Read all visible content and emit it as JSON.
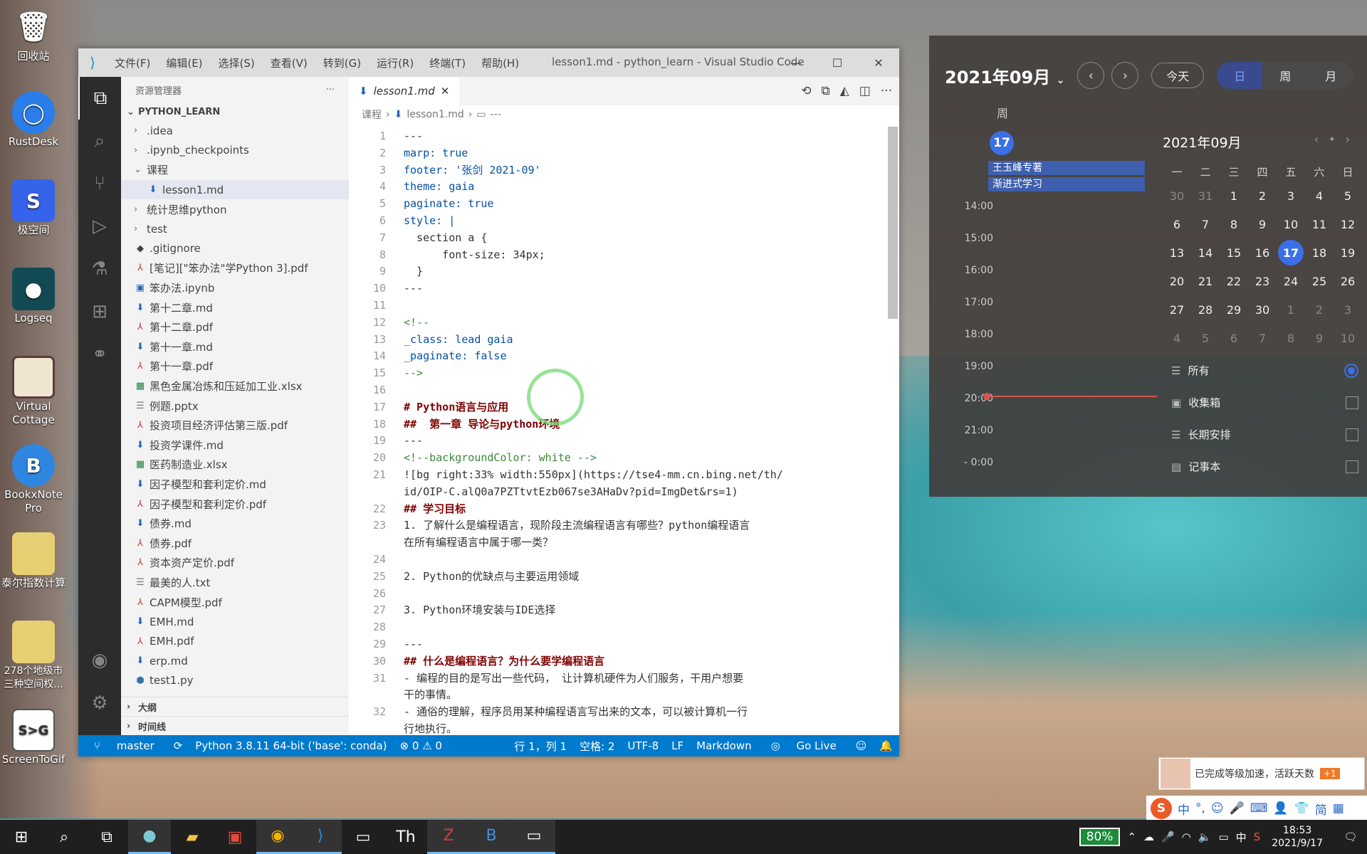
{
  "desktop": {
    "icons": [
      "回收站",
      "RustDesk",
      "极空间",
      "Logseq",
      "Virtual Cottage",
      "BookxNote Pro",
      "泰尔指数计算",
      "278个地级市三种空间权...",
      "ScreenToGif"
    ]
  },
  "vscode": {
    "menu": [
      "文件(F)",
      "编辑(E)",
      "选择(S)",
      "查看(V)",
      "转到(G)",
      "运行(R)",
      "终端(T)",
      "帮助(H)"
    ],
    "title": "lesson1.md - python_learn - Visual Studio Code",
    "explorer_title": "资源管理器",
    "explorer_more": "···",
    "root": "PYTHON_LEARN",
    "tree": [
      {
        "label": ".idea",
        "kind": "folder",
        "open": false,
        "indent": 1
      },
      {
        "label": ".ipynb_checkpoints",
        "kind": "folder",
        "open": false,
        "indent": 1
      },
      {
        "label": "课程",
        "kind": "folder",
        "open": true,
        "indent": 1
      },
      {
        "label": "lesson1.md",
        "kind": "md",
        "indent": 2,
        "selected": true
      },
      {
        "label": "统计思维python",
        "kind": "folder",
        "open": false,
        "indent": 1
      },
      {
        "label": "test",
        "kind": "folder",
        "open": false,
        "indent": 1
      },
      {
        "label": ".gitignore",
        "kind": "git",
        "indent": 1
      },
      {
        "label": "[笔记][\"笨办法\"学Python 3].pdf",
        "kind": "pdf",
        "indent": 1
      },
      {
        "label": "笨办法.ipynb",
        "kind": "ipynb",
        "indent": 1
      },
      {
        "label": "第十二章.md",
        "kind": "md",
        "indent": 1
      },
      {
        "label": "第十二章.pdf",
        "kind": "pdf",
        "indent": 1
      },
      {
        "label": "第十一章.md",
        "kind": "md",
        "indent": 1
      },
      {
        "label": "第十一章.pdf",
        "kind": "pdf",
        "indent": 1
      },
      {
        "label": "黑色金属冶炼和压延加工业.xlsx",
        "kind": "xlsx",
        "indent": 1
      },
      {
        "label": "例题.pptx",
        "kind": "txt",
        "indent": 1
      },
      {
        "label": "投资项目经济评估第三版.pdf",
        "kind": "pdf",
        "indent": 1
      },
      {
        "label": "投资学课件.md",
        "kind": "md",
        "indent": 1
      },
      {
        "label": "医药制造业.xlsx",
        "kind": "xlsx",
        "indent": 1
      },
      {
        "label": "因子模型和套利定价.md",
        "kind": "md",
        "indent": 1
      },
      {
        "label": "因子模型和套利定价.pdf",
        "kind": "pdf",
        "indent": 1
      },
      {
        "label": "债券.md",
        "kind": "md",
        "indent": 1
      },
      {
        "label": "债券.pdf",
        "kind": "pdf",
        "indent": 1
      },
      {
        "label": "资本资产定价.pdf",
        "kind": "pdf",
        "indent": 1
      },
      {
        "label": "最美的人.txt",
        "kind": "txt",
        "indent": 1
      },
      {
        "label": "CAPM模型.pdf",
        "kind": "pdf",
        "indent": 1
      },
      {
        "label": "EMH.md",
        "kind": "md",
        "indent": 1
      },
      {
        "label": "EMH.pdf",
        "kind": "pdf",
        "indent": 1
      },
      {
        "label": "erp.md",
        "kind": "md",
        "indent": 1
      },
      {
        "label": "test1.py",
        "kind": "py",
        "indent": 1
      }
    ],
    "outline_label": "大纲",
    "timeline_label": "时间线",
    "tab": "lesson1.md",
    "breadcrumb": [
      "课程",
      "lesson1.md",
      "---"
    ],
    "code": [
      {
        "n": "1",
        "t": "---"
      },
      {
        "n": "2",
        "t": "marp: true"
      },
      {
        "n": "3",
        "t": "footer: '张剑 2021-09'"
      },
      {
        "n": "4",
        "t": "theme: gaia"
      },
      {
        "n": "5",
        "t": "paginate: true"
      },
      {
        "n": "6",
        "t": "style: |"
      },
      {
        "n": "7",
        "t": "  section a {"
      },
      {
        "n": "8",
        "t": "      font-size: 34px;"
      },
      {
        "n": "9",
        "t": "  }"
      },
      {
        "n": "10",
        "t": "---"
      },
      {
        "n": "11",
        "t": ""
      },
      {
        "n": "12",
        "t": "<!--"
      },
      {
        "n": "13",
        "t": "_class: lead gaia"
      },
      {
        "n": "14",
        "t": "_paginate: false"
      },
      {
        "n": "15",
        "t": "-->"
      },
      {
        "n": "16",
        "t": ""
      },
      {
        "n": "17",
        "t": "# Python语言与应用"
      },
      {
        "n": "18",
        "t": "##  第一章 导论与python环境"
      },
      {
        "n": "19",
        "t": "---"
      },
      {
        "n": "20",
        "t": "<!--backgroundColor: white -->"
      },
      {
        "n": "21",
        "t": "![bg right:33% width:550px](https://tse4-mm.cn.bing.net/th/"
      },
      {
        "n": "",
        "t": "id/OIP-C.alQ0a7PZTtvtEzb067se3AHaDv?pid=ImgDet&rs=1)"
      },
      {
        "n": "22",
        "t": "## 学习目标"
      },
      {
        "n": "23",
        "t": "1. 了解什么是编程语言，现阶段主流编程语言有哪些？python编程语言"
      },
      {
        "n": "",
        "t": "在所有编程语言中属于哪一类？"
      },
      {
        "n": "24",
        "t": ""
      },
      {
        "n": "25",
        "t": "2. Python的优缺点与主要运用领域"
      },
      {
        "n": "26",
        "t": ""
      },
      {
        "n": "27",
        "t": "3. Python环境安装与IDE选择"
      },
      {
        "n": "28",
        "t": ""
      },
      {
        "n": "29",
        "t": "---"
      },
      {
        "n": "30",
        "t": "## 什么是编程语言？为什么要学编程语言"
      },
      {
        "n": "31",
        "t": "- 编程的目的是写出一些代码， 让计算机硬件为人们服务，干用户想要"
      },
      {
        "n": "",
        "t": "干的事情。"
      },
      {
        "n": "32",
        "t": "- 通俗的理解，程序员用某种编程语言写出来的文本，可以被计算机一行"
      },
      {
        "n": "",
        "t": "行地执行。"
      }
    ],
    "status": {
      "branch": "master",
      "python": "Python 3.8.11 64-bit ('base': conda)",
      "problems": "⊗ 0 ⚠ 0",
      "position": "行 1，列 1",
      "spaces": "空格: 2",
      "encoding": "UTF-8",
      "eol": "LF",
      "language": "Markdown",
      "golive": "Go Live"
    }
  },
  "calendar": {
    "title": "2021年09月",
    "today_btn": "今天",
    "views": [
      "日",
      "周",
      "月"
    ],
    "week_label": "周",
    "day_badge": "17",
    "events": [
      "王玉峰专著",
      "渐进式学习"
    ],
    "times": [
      "14:00",
      "15:00",
      "16:00",
      "17:00",
      "18:00",
      "19:00",
      "20:00",
      "21:00"
    ],
    "times_end": "- 0:00",
    "mini_title": "2021年09月",
    "dow": [
      "一",
      "二",
      "三",
      "四",
      "五",
      "六",
      "日"
    ],
    "days": [
      [
        "30",
        "31",
        "1",
        "2",
        "3",
        "4",
        "5"
      ],
      [
        "6",
        "7",
        "8",
        "9",
        "10",
        "11",
        "12"
      ],
      [
        "13",
        "14",
        "15",
        "16",
        "17",
        "18",
        "19"
      ],
      [
        "20",
        "21",
        "22",
        "23",
        "24",
        "25",
        "26"
      ],
      [
        "27",
        "28",
        "29",
        "30",
        "1",
        "2",
        "3"
      ],
      [
        "4",
        "5",
        "6",
        "7",
        "8",
        "9",
        "10"
      ]
    ],
    "categories": [
      "所有",
      "收集箱",
      "长期安排",
      "记事本"
    ]
  },
  "notification": {
    "text": "已完成等级加速，活跃天数",
    "badge": "+1"
  },
  "ime": {
    "lang": "中",
    "mode": "简"
  },
  "taskbar": {
    "battery": "80%",
    "tray_lang": "中",
    "time": "18:53",
    "date": "2021/9/17"
  }
}
